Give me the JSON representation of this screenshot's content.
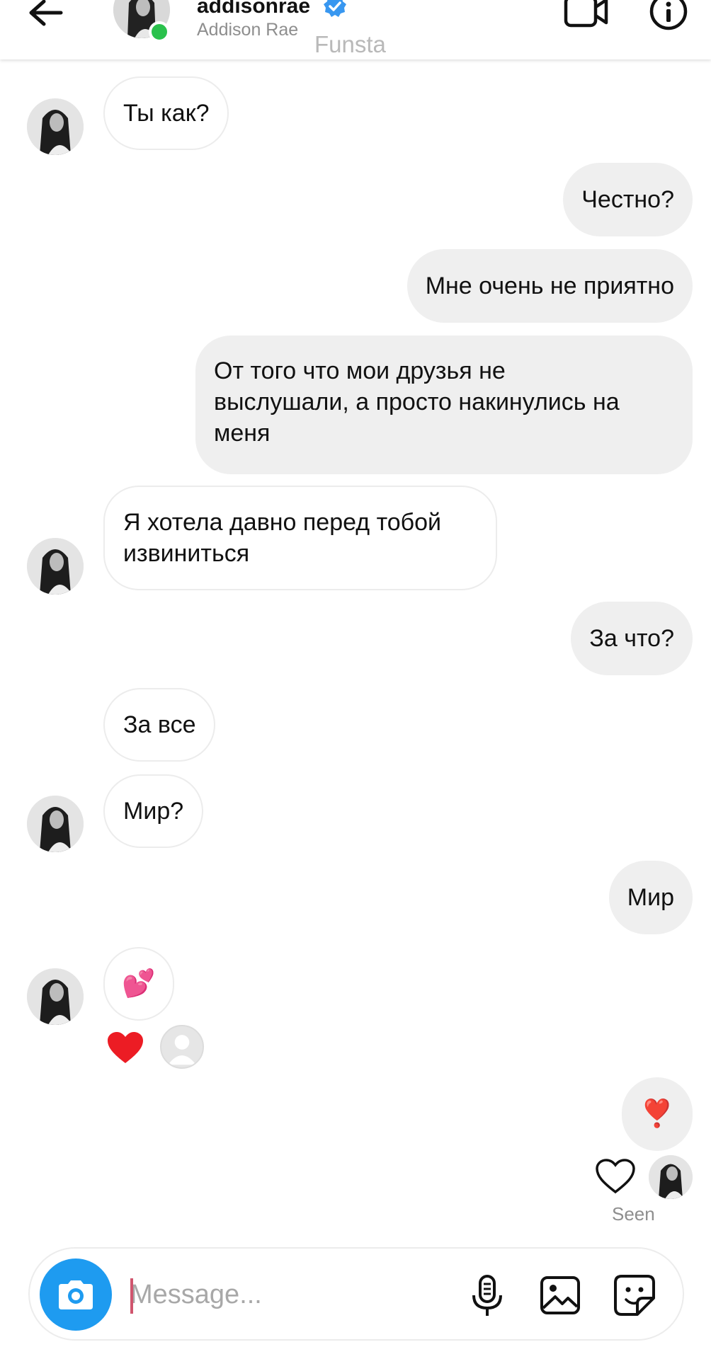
{
  "header": {
    "username": "addisonrae",
    "full_name": "Addison Rae",
    "overlay_label": "Funsta",
    "online_color": "#2ac14c",
    "verified_color": "#3897f0",
    "icons": [
      "back-arrow-icon",
      "verified-badge-icon",
      "video-call-icon",
      "info-icon"
    ]
  },
  "messages": [
    {
      "direction": "in",
      "text": "Ты как?"
    },
    {
      "direction": "out",
      "text": "Честно?"
    },
    {
      "direction": "out",
      "text": "Мне очень не приятно"
    },
    {
      "direction": "out",
      "text": "От того что мои друзья не\nвыслушали, а просто накинулись на\nменя"
    },
    {
      "direction": "in",
      "text": "Я хотела давно перед тобой\nизвиниться"
    },
    {
      "direction": "out",
      "text": "За что?"
    },
    {
      "direction": "in",
      "text": "За все"
    },
    {
      "direction": "in",
      "text": "Мир?"
    },
    {
      "direction": "out",
      "text": "Мир"
    },
    {
      "direction": "in",
      "text": "💕"
    },
    {
      "direction": "out",
      "text": "❣️"
    }
  ],
  "reaction": {
    "emoji": "heart",
    "color": "#ec1c24"
  },
  "seen": {
    "label": "Seen"
  },
  "composer": {
    "placeholder": "Message...",
    "value": "",
    "camera_color": "#1e9bf0",
    "icons": [
      "camera-icon",
      "microphone-icon",
      "gallery-icon",
      "sticker-icon"
    ]
  }
}
